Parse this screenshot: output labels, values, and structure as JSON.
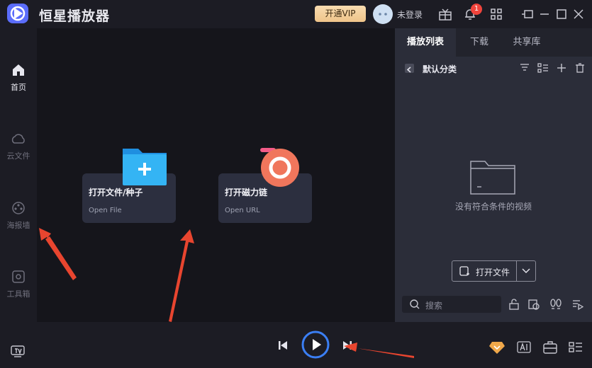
{
  "titlebar": {
    "app_name": "恒星播放器",
    "vip_label": "开通VIP",
    "login_label": "未登录",
    "notification_count": "1"
  },
  "nav": {
    "items": [
      {
        "label": "首页",
        "icon": "home-icon",
        "active": true
      },
      {
        "label": "云文件",
        "icon": "cloud-icon",
        "active": false
      },
      {
        "label": "海报墙",
        "icon": "film-reel-icon",
        "active": false
      },
      {
        "label": "工具箱",
        "icon": "toolbox-icon",
        "active": false
      }
    ]
  },
  "center": {
    "cards": [
      {
        "title": "打开文件/种子",
        "subtitle": "Open File",
        "icon": "folder-plus-icon"
      },
      {
        "title": "打开磁力链",
        "subtitle": "Open URL",
        "icon": "magnet-icon"
      }
    ]
  },
  "panel": {
    "tabs": [
      "播放列表",
      "下载",
      "共享库"
    ],
    "category": "默认分类",
    "empty_message": "没有符合条件的视频",
    "open_file_label": "打开文件",
    "search_placeholder": "搜索"
  },
  "colors": {
    "accent": "#3b7ff5",
    "brand": "#5b6dfb",
    "annotation_arrow": "#e8452f",
    "vip_gold": "#efc48a"
  }
}
